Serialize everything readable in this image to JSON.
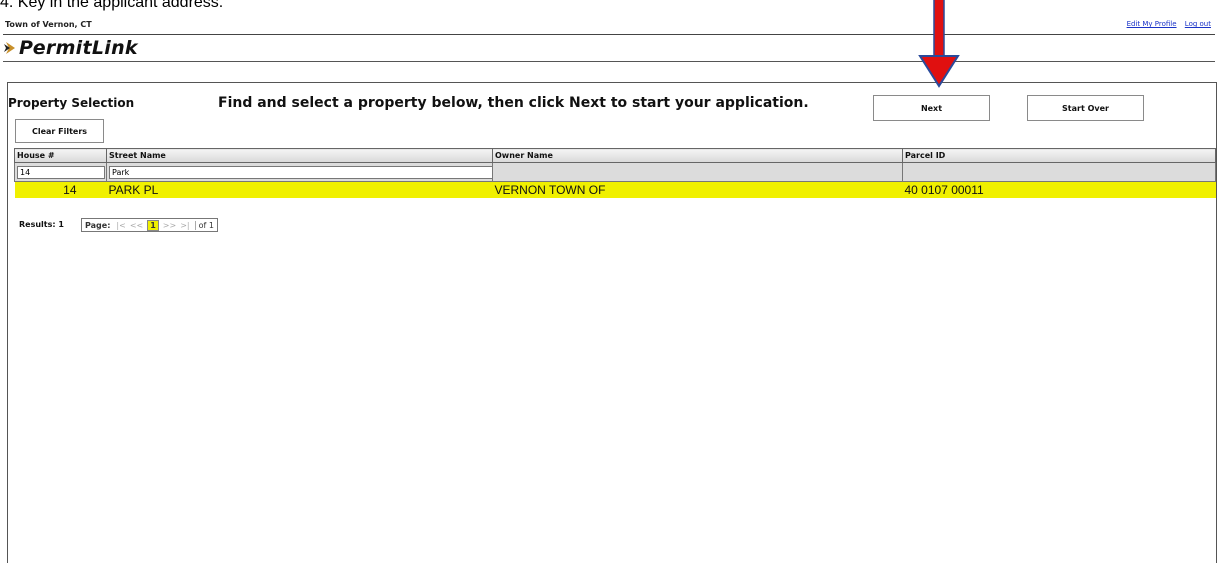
{
  "caption": "4. Key in the applicant address.",
  "header": {
    "town": "Town of Vernon, CT",
    "links": {
      "edit_profile": "Edit My Profile",
      "logout": "Log out"
    }
  },
  "logo": {
    "text": "PermitLink"
  },
  "page": {
    "title": "Property Selection",
    "instructions": "Find and select a property below, then click Next to start your application.",
    "next_label": "Next",
    "start_over_label": "Start Over",
    "clear_filters_label": "Clear Filters"
  },
  "grid": {
    "columns": [
      "House #",
      "Street Name",
      "Owner Name",
      "Parcel ID"
    ],
    "filters": {
      "house": "14",
      "street": "Park",
      "owner": "",
      "parcel": ""
    },
    "rows": [
      {
        "house": "14",
        "street": "PARK PL",
        "owner": "VERNON TOWN OF",
        "parcel": "40 0107 00011"
      }
    ]
  },
  "pager": {
    "results_label": "Results: 1",
    "page_label": "Page:",
    "first": "|<",
    "prev": "<<",
    "current": "1",
    "next": ">>",
    "last": ">|",
    "of": "of 1"
  },
  "colors": {
    "highlight": "#f0f000",
    "arrow": "#e01010",
    "arrow_outline": "#2a4a9a",
    "link": "#1a33c8"
  },
  "icons": {
    "logo_mark": "chevron-logo-icon",
    "annotation": "red-down-arrow-icon"
  }
}
